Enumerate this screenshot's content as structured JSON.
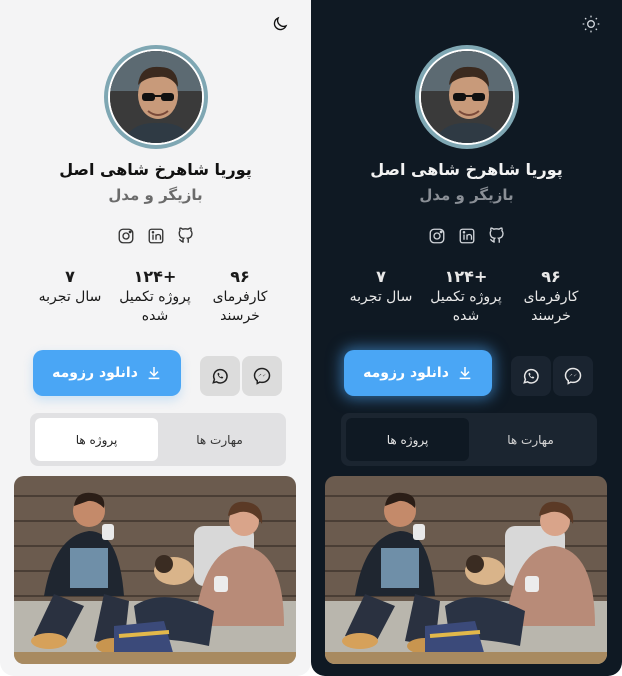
{
  "profile": {
    "name": "پوریا شاهرخ شاهی اصل",
    "role": "بازیگر و مدل"
  },
  "socials": [
    "instagram-icon",
    "linkedin-icon",
    "github-icon"
  ],
  "stats": [
    {
      "value": "۹۶",
      "label": "کارفرمای خرسند"
    },
    {
      "value": "+۱۲۴",
      "label": "پروژه تکمیل شده"
    },
    {
      "value": "۷",
      "label": "سال تجربه"
    }
  ],
  "actions": {
    "download_label": "دانلود رزومه",
    "whatsapp_icon": "whatsapp-icon",
    "messenger_icon": "messenger-icon"
  },
  "tabs": [
    {
      "label": "مهارت ها",
      "active": false
    },
    {
      "label": "پروژه ها",
      "active": true
    }
  ],
  "themes": {
    "light_toggle_icon": "moon-icon",
    "dark_toggle_icon": "sun-icon"
  },
  "colors": {
    "accent": "#4aa6f5",
    "light_bg": "#f4f4f5",
    "dark_bg": "#0f1923"
  }
}
